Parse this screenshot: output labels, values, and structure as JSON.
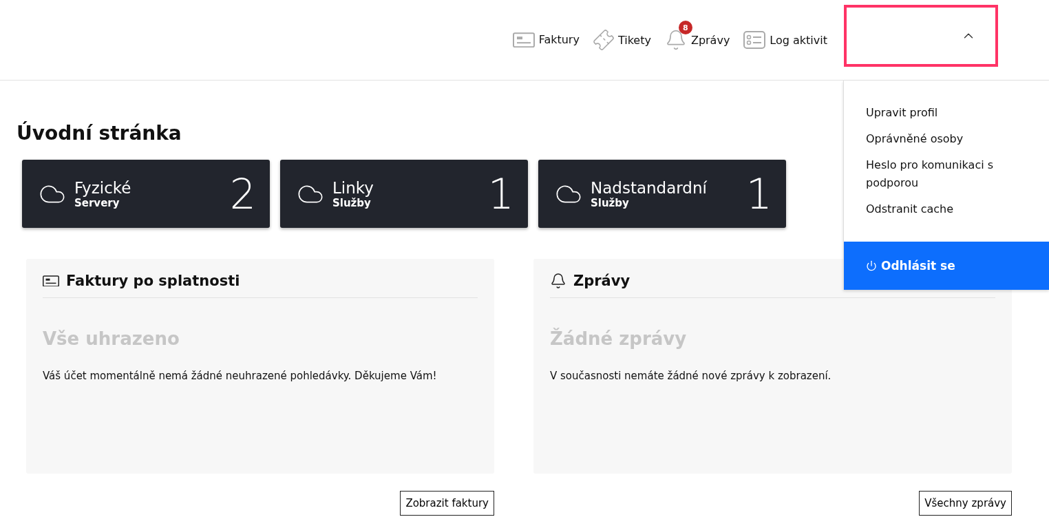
{
  "nav": [
    {
      "kind": "invoice",
      "label": "Faktury"
    },
    {
      "kind": "ticket",
      "label": "Tikety"
    },
    {
      "kind": "bell",
      "label": "Zprávy",
      "badge": "8"
    },
    {
      "kind": "log",
      "label": "Log aktivit"
    }
  ],
  "user_menu": {
    "expanded": true,
    "items": [
      "Upravit profil",
      "Oprávněné osoby",
      "Heslo pro komunikaci s podporou",
      "Odstranit cache"
    ],
    "logout": "Odhlásit se"
  },
  "page_title": "Úvodní stránka",
  "stats": [
    {
      "title": "Fyzické",
      "subtitle": "Servery",
      "count": "2"
    },
    {
      "title": "Linky",
      "subtitle": "Služby",
      "count": "1"
    },
    {
      "title": "Nadstandardní",
      "subtitle": "Služby",
      "count": "1"
    }
  ],
  "panels": [
    {
      "kind": "invoice",
      "title": "Faktury po splatnosti",
      "empty_title": "Vše uhrazeno",
      "message": "Váš účet momentálně nemá žádné neuhrazené pohledávky. Děkujeme Vám!",
      "button": "Zobrazit faktury"
    },
    {
      "kind": "bell",
      "title": "Zprávy",
      "empty_title": "Žádné zprávy",
      "message": "V současnosti nemáte žádné nové zprávy k zobrazení.",
      "button": "Všechny zprávy"
    }
  ]
}
